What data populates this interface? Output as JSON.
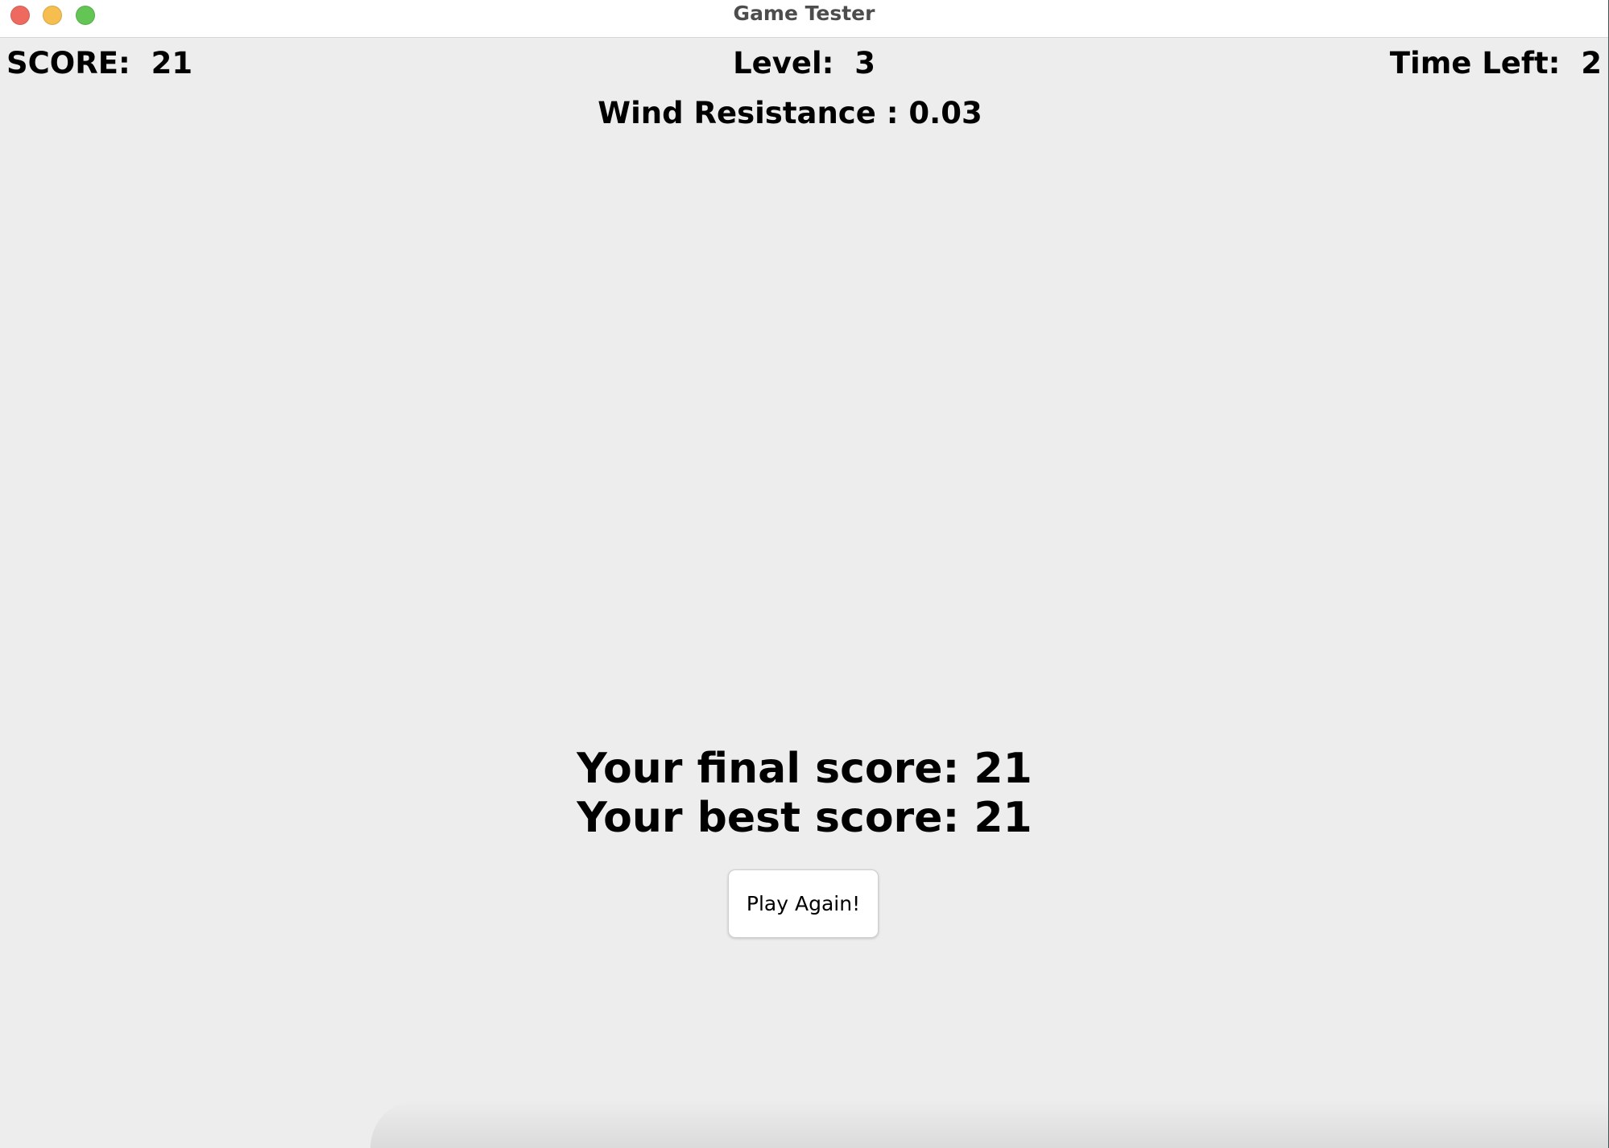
{
  "window": {
    "title": "Game Tester",
    "controls": {
      "close_color": "#ee6a5f",
      "minimize_color": "#f5be4f",
      "maximize_color": "#62c554"
    }
  },
  "hud": {
    "score_text": "SCORE:  21",
    "level_text": "Level:  3",
    "time_left_text": "Time Left:  2",
    "wind_text": "Wind Resistance : 0.03"
  },
  "game_over": {
    "final_score_text": "Your final score: 21",
    "best_score_text": "Your best score: 21",
    "play_again_label": "Play Again!"
  },
  "colors": {
    "background": "#ededed",
    "text": "#000000",
    "button_bg": "#ffffff"
  }
}
